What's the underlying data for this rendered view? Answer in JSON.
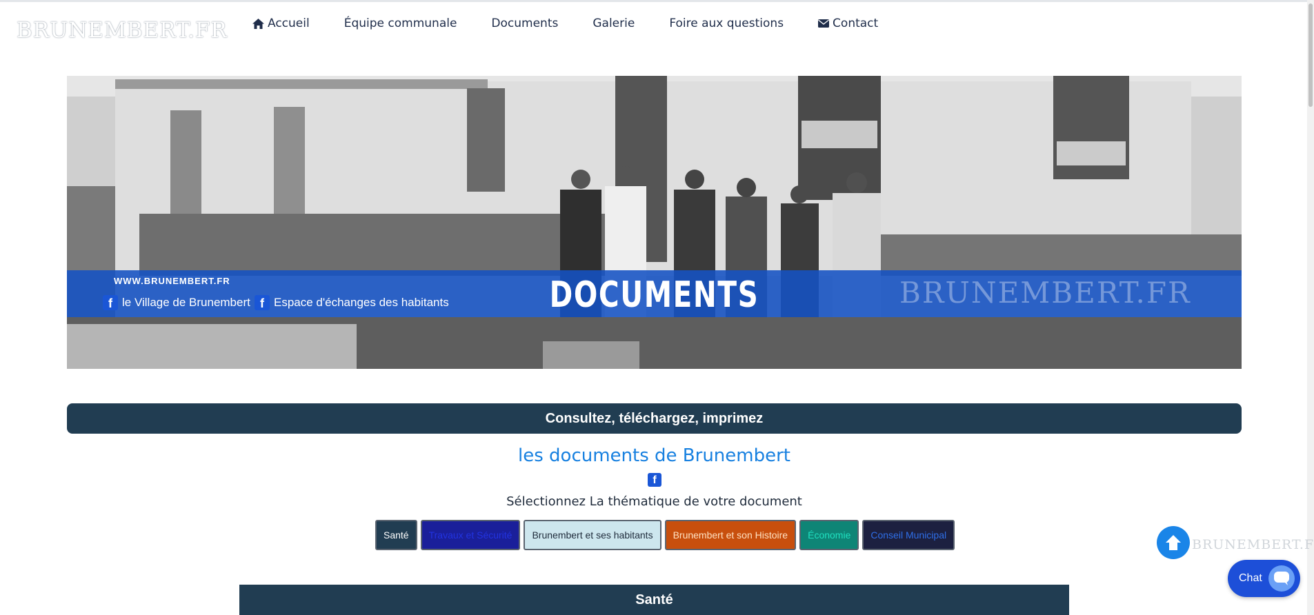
{
  "site": {
    "logo_text": "BRUNEMBERT.FR"
  },
  "nav": {
    "items": [
      {
        "label": "Accueil",
        "icon": "home-icon"
      },
      {
        "label": "Équipe communale"
      },
      {
        "label": "Documents"
      },
      {
        "label": "Galerie"
      },
      {
        "label": "Foire aux questions"
      },
      {
        "label": "Contact",
        "icon": "envelope-icon"
      }
    ]
  },
  "hero": {
    "url_text": "WWW.BRUNEMBERT.FR",
    "fb_links": [
      "le Village de Brunembert",
      "Espace d'échanges des habitants"
    ],
    "title": "DOCUMENTS",
    "watermark": "BRUNEMBERT.FR"
  },
  "section_title": "Consultez, téléchargez, imprimez",
  "documents_heading": "les documents de Brunembert",
  "select_label": "Sélectionnez La thématique de votre document",
  "themes": [
    {
      "label": "Santé",
      "bg": "#213d52",
      "fg": "#ffffff"
    },
    {
      "label": "Travaux et Sécurité",
      "bg": "#1a1f9a",
      "fg": "#2233e0"
    },
    {
      "label": "Brunembert et ses habitants",
      "bg": "#cde6ee",
      "fg": "#1e2a3a"
    },
    {
      "label": "Brunembert et son Histoire",
      "bg": "#c84f0d",
      "fg": "#ffe2c2"
    },
    {
      "label": "Économie",
      "bg": "#0e8576",
      "fg": "#1fe0c0"
    },
    {
      "label": "Conseil Municipal",
      "bg": "#1c2040",
      "fg": "#2f6fe8"
    }
  ],
  "active_section": "Santé",
  "scroll_watermark": "BRUNEMBERT.FR",
  "chat": {
    "label": "Chat"
  },
  "colors": {
    "accent": "#1780e0",
    "dark_bar": "#213d52",
    "hero_band": "#1552c4"
  }
}
